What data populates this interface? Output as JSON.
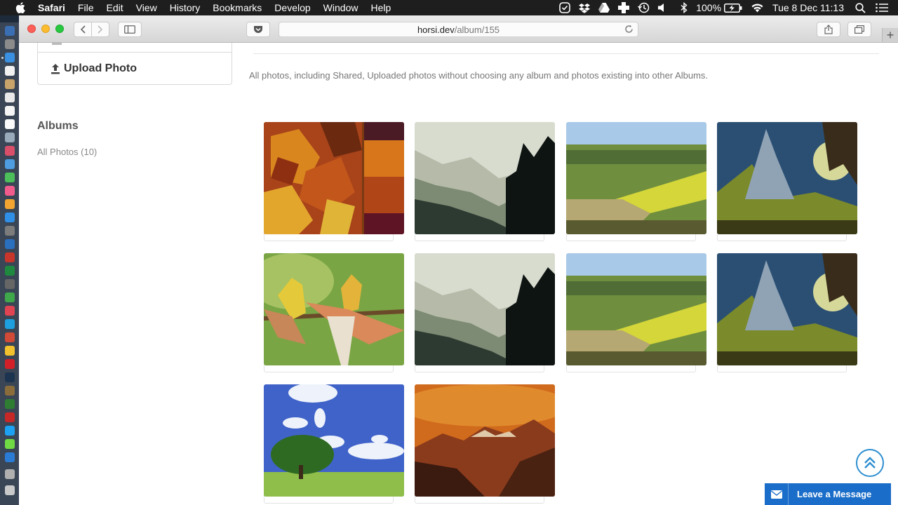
{
  "menubar": {
    "app_name": "Safari",
    "menus": [
      "File",
      "Edit",
      "View",
      "History",
      "Bookmarks",
      "Develop",
      "Window",
      "Help"
    ],
    "battery": "100%",
    "clock": "Tue 8 Dec  11:13"
  },
  "browser": {
    "url_host": "horsi.dev",
    "url_path": "/album/155"
  },
  "sidebar": {
    "upload_label": "Upload Photo",
    "albums_heading": "Albums",
    "all_photos_label": "All Photos (10)"
  },
  "main": {
    "description": "All photos, including Shared, Uploaded photos without choosing any album and photos existing into other Albums.",
    "photos": [
      {
        "subject": "autumn leaves with color palette"
      },
      {
        "subject": "misty forest valley"
      },
      {
        "subject": "green fields countryside"
      },
      {
        "subject": "fantasy mountain landscape"
      },
      {
        "subject": "bee-eater birds"
      },
      {
        "subject": "misty forest valley"
      },
      {
        "subject": "green fields countryside"
      },
      {
        "subject": "fantasy mountain landscape"
      },
      {
        "subject": "tree under blue sky"
      },
      {
        "subject": "orange mountain sunset"
      }
    ]
  },
  "chat_widget": {
    "label": "Leave a Message"
  },
  "colors": {
    "accent": "#1a6dc8",
    "scroll_top": "#2f8fd1"
  }
}
